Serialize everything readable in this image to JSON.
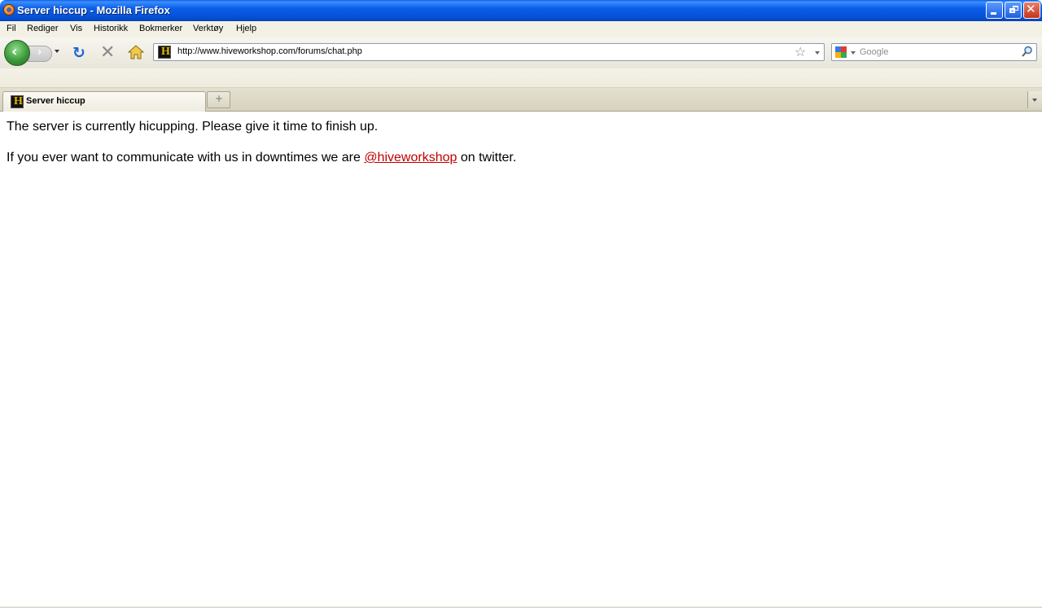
{
  "window": {
    "title": "Server hiccup - Mozilla Firefox"
  },
  "menu": {
    "items": [
      "Fil",
      "Rediger",
      "Vis",
      "Historikk",
      "Bokmerker",
      "Verktøy",
      "Hjelp"
    ]
  },
  "navigation": {
    "url": "http://www.hiveworkshop.com/forums/chat.php",
    "search_placeholder": "Google"
  },
  "tabs": [
    {
      "title": "Server hiccup",
      "active": true
    }
  ],
  "page": {
    "line1": "The server is currently hicupping. Please give it time to finish up.",
    "line2_before": "If you ever want to communicate with us in downtimes we are ",
    "line2_link": "@hiveworkshop",
    "line2_after": " on twitter."
  },
  "colors": {
    "titlebar": "#0a5ee8",
    "link": "#c00000"
  },
  "icons": {
    "site": "hiveworkshop-logo-icon",
    "search_engine": "google-icon"
  }
}
